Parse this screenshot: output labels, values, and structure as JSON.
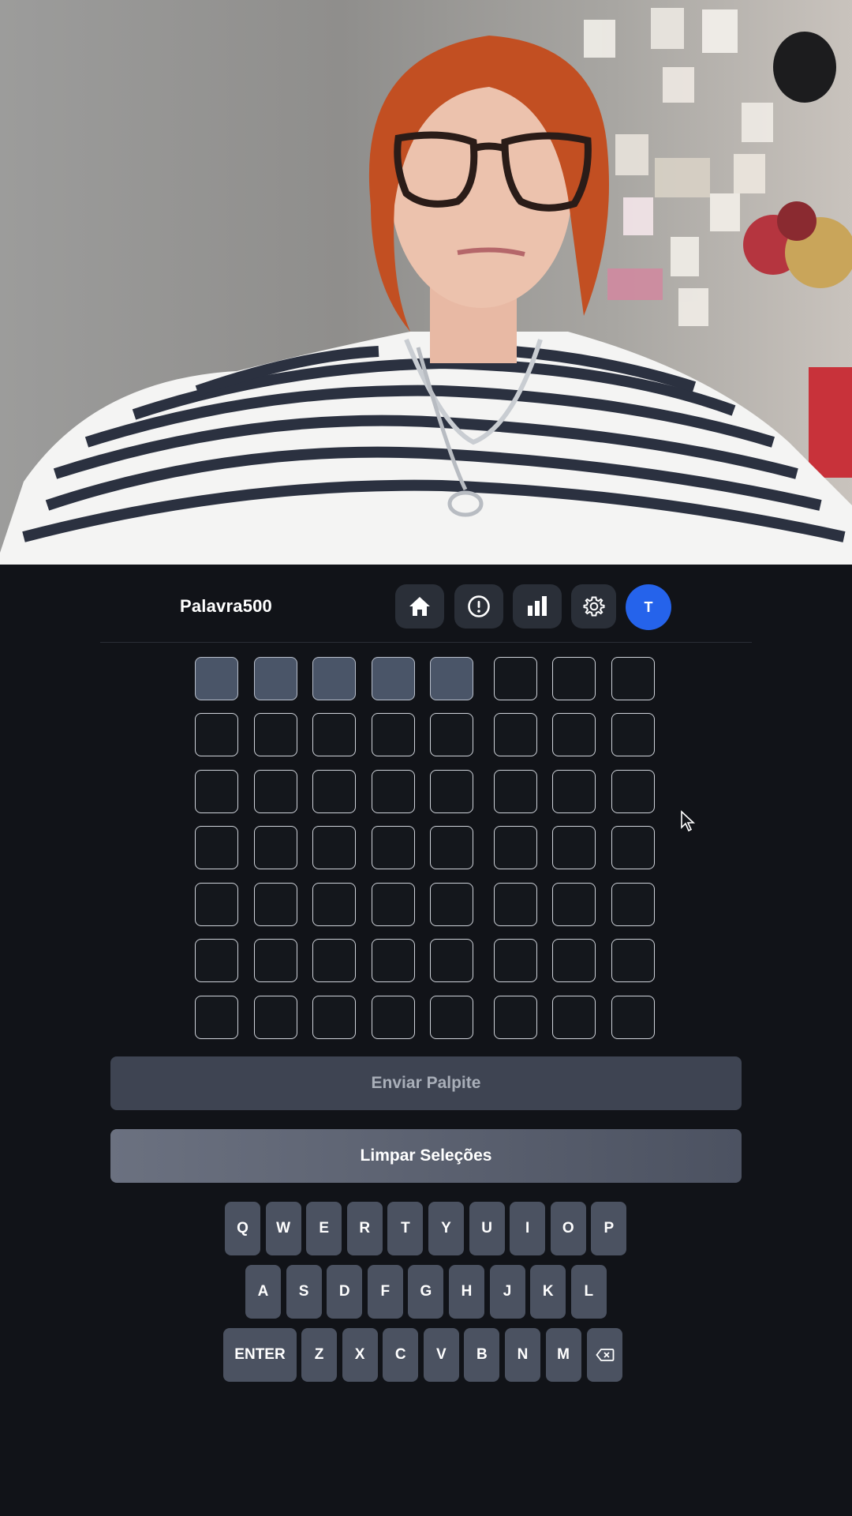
{
  "header": {
    "brand": "Palavra500",
    "avatar_initial": "T",
    "icons": [
      "home-icon",
      "info-icon",
      "stats-icon",
      "settings-icon"
    ]
  },
  "board": {
    "rows": 7,
    "cols": 8,
    "filled_first_row": 5
  },
  "actions": {
    "send_label": "Enviar Palpite",
    "clear_label": "Limpar Seleções"
  },
  "keyboard": {
    "row1": [
      "Q",
      "W",
      "E",
      "R",
      "T",
      "Y",
      "U",
      "I",
      "O",
      "P"
    ],
    "row2": [
      "A",
      "S",
      "D",
      "F",
      "G",
      "H",
      "J",
      "K",
      "L"
    ],
    "row3": [
      "ENTER",
      "Z",
      "X",
      "C",
      "V",
      "B",
      "N",
      "M",
      "backspace-icon"
    ]
  },
  "colors": {
    "background": "#111318",
    "tile_filled": "#4a5568",
    "avatar": "#2563eb",
    "key": "#4b5261"
  }
}
